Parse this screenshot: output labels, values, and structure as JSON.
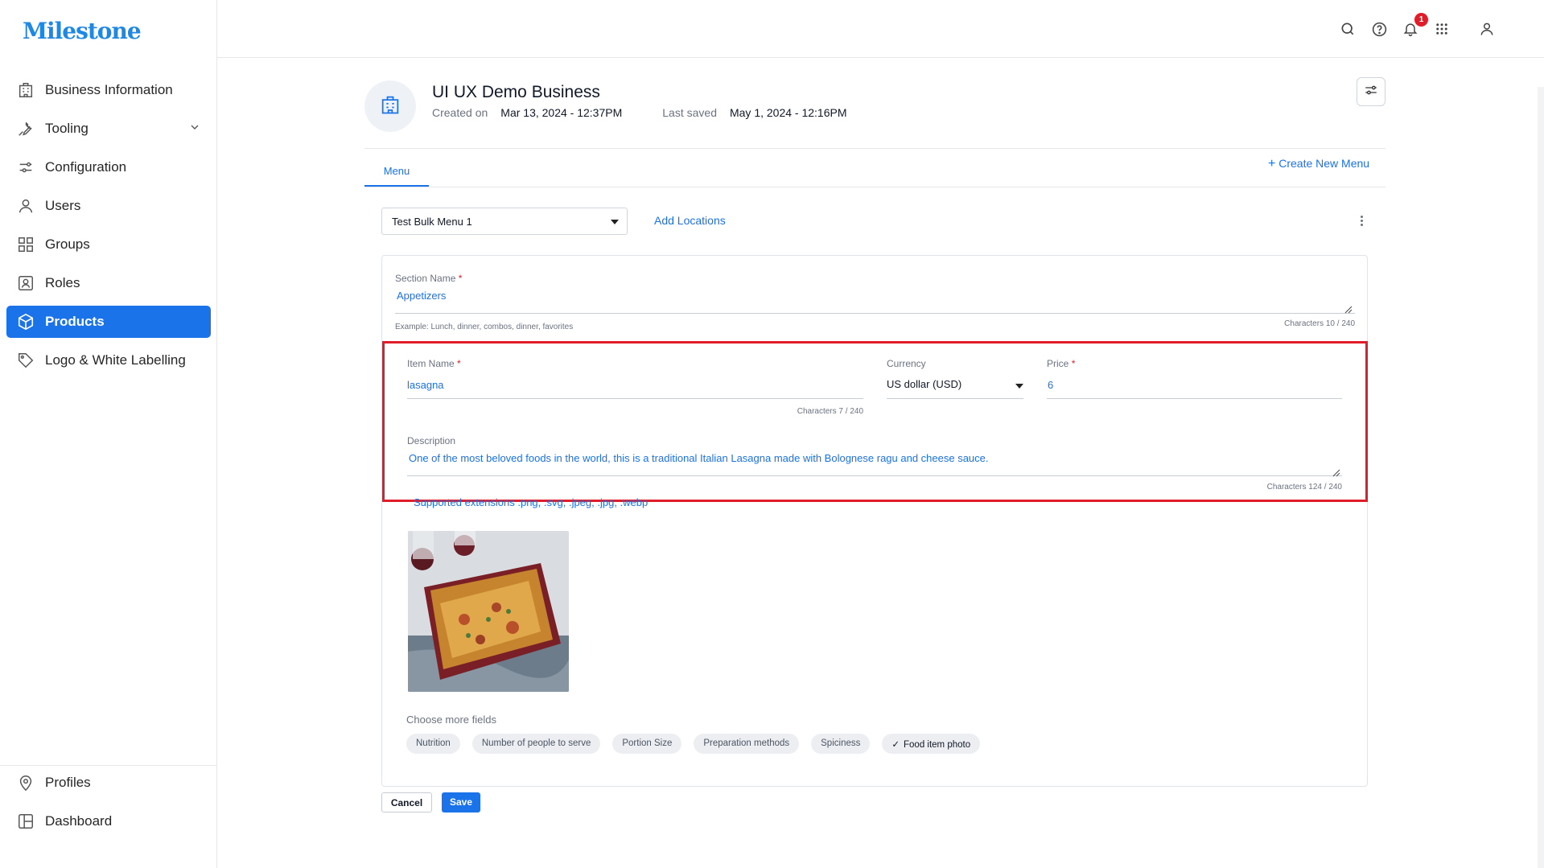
{
  "app": {
    "logo_text": "Milestone"
  },
  "sidebar": {
    "items": [
      {
        "label": "Business Information",
        "icon": "building-icon"
      },
      {
        "label": "Tooling",
        "icon": "wrench-icon"
      },
      {
        "label": "Configuration",
        "icon": "sliders-icon"
      },
      {
        "label": "Users",
        "icon": "user-icon"
      },
      {
        "label": "Groups",
        "icon": "grid-icon"
      },
      {
        "label": "Roles",
        "icon": "id-card-icon"
      },
      {
        "label": "Products",
        "icon": "box-icon",
        "active": true
      },
      {
        "label": "Logo & White Labelling",
        "icon": "tag-icon"
      }
    ],
    "bottom_items": [
      {
        "label": "Profiles",
        "icon": "location-pin-icon"
      },
      {
        "label": "Dashboard",
        "icon": "dashboard-icon"
      }
    ]
  },
  "topbar": {
    "notification_count": "1"
  },
  "business": {
    "name": "UI UX Demo Business",
    "created_label": "Created on",
    "created_value": "Mar 13, 2024 - 12:37PM",
    "saved_label": "Last saved",
    "saved_value": "May 1, 2024 - 12:16PM"
  },
  "tabs": {
    "menu": "Menu",
    "create_new": "Create New Menu"
  },
  "menu_selector": {
    "selected": "Test Bulk Menu 1",
    "add_locations": "Add Locations"
  },
  "section": {
    "name_label": "Section Name",
    "name_value": "Appetizers",
    "name_hint": "Example: Lunch, dinner, combos, dinner, favorites",
    "name_counter": "Characters 10 / 240"
  },
  "item": {
    "name_label": "Item Name",
    "name_value": "lasagna",
    "name_counter": "Characters 7 / 240",
    "currency_label": "Currency",
    "currency_value": "US dollar (USD)",
    "price_label": "Price",
    "price_value": "6",
    "description_label": "Description",
    "description_value": "One of the most beloved foods in the world, this is a traditional Italian Lasagna made with Bolognese ragu and cheese sauce.",
    "description_counter": "Characters 124 / 240",
    "supported_extensions": "Supported extensions .png, .svg, .jpeg, .jpg, .webp"
  },
  "more_fields": {
    "label": "Choose more fields",
    "chips": [
      {
        "label": "Nutrition",
        "selected": false
      },
      {
        "label": "Number of people to serve",
        "selected": false
      },
      {
        "label": "Portion Size",
        "selected": false
      },
      {
        "label": "Preparation methods",
        "selected": false
      },
      {
        "label": "Spiciness",
        "selected": false
      },
      {
        "label": "Food item photo",
        "selected": true
      }
    ]
  },
  "actions": {
    "cancel": "Cancel",
    "save": "Save"
  },
  "colors": {
    "accent": "#1a73e8",
    "highlight": "#e11d2a",
    "badge": "#e11d2a"
  }
}
